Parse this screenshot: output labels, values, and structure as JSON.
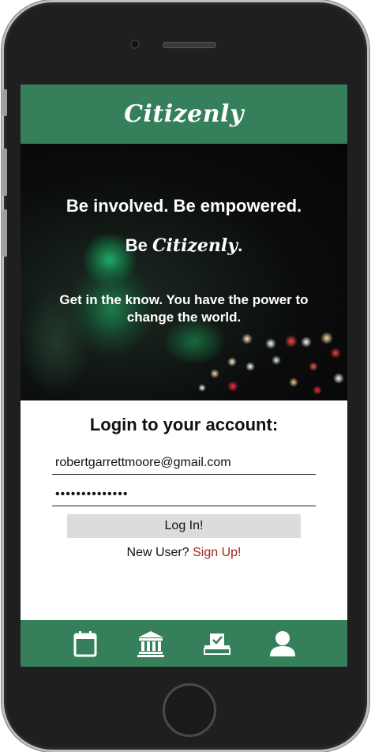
{
  "app": {
    "title": "Citizenly"
  },
  "hero": {
    "line1": "Be involved. Be empowered.",
    "line2_prefix": "Be ",
    "line2_brand": "Citizenly",
    "line2_suffix": ".",
    "line3": "Get in the know. You have the power to change the world."
  },
  "login": {
    "title": "Login to your account:",
    "email_value": "robertgarrettmoore@gmail.com",
    "password_value": "••••••••••••••",
    "button_label": "Log In!",
    "new_user_text": "New User?",
    "signup_label": "Sign Up!"
  },
  "tabs": [
    {
      "icon": "calendar-icon"
    },
    {
      "icon": "government-building-icon"
    },
    {
      "icon": "ballot-box-icon"
    },
    {
      "icon": "user-profile-icon"
    }
  ],
  "colors": {
    "brand_green": "#35805a",
    "signup_red": "#a32418",
    "button_gray": "#dcdcdc"
  }
}
